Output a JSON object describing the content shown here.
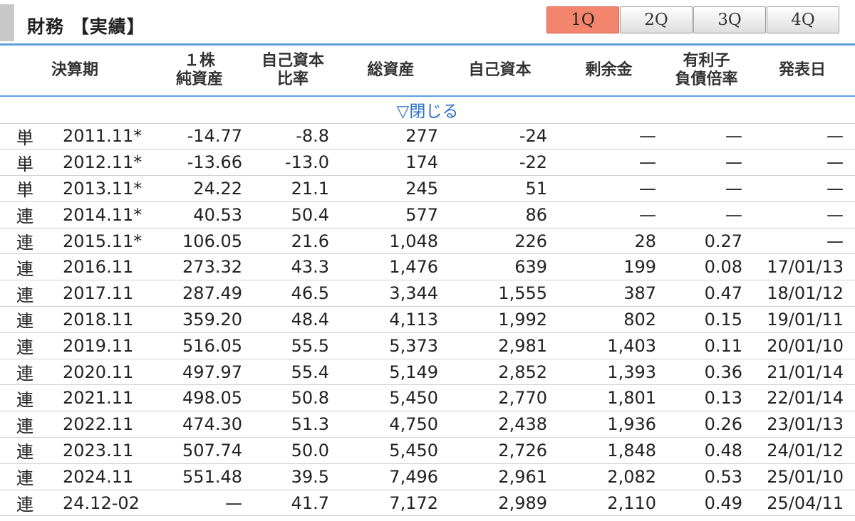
{
  "header": {
    "title": "財務 【実績】",
    "quarter_tabs": [
      {
        "label": "1Q",
        "active": true
      },
      {
        "label": "2Q",
        "active": false
      },
      {
        "label": "3Q",
        "active": false
      },
      {
        "label": "4Q",
        "active": false
      }
    ]
  },
  "table": {
    "columns": [
      {
        "line1": "決算期",
        "line2": ""
      },
      {
        "line1": "１株",
        "line2": "純資産"
      },
      {
        "line1": "自己資本",
        "line2": "比率"
      },
      {
        "line1": "総資産",
        "line2": ""
      },
      {
        "line1": "自己資本",
        "line2": ""
      },
      {
        "line1": "剰余金",
        "line2": ""
      },
      {
        "line1": "有利子",
        "line2": "負債倍率"
      },
      {
        "line1": "発表日",
        "line2": ""
      }
    ],
    "toggle_label": "▽閉じる",
    "rows": [
      [
        "単",
        "2011.11*",
        "-14.77",
        "-8.8",
        "277",
        "-24",
        "—",
        "—",
        "—"
      ],
      [
        "単",
        "2012.11*",
        "-13.66",
        "-13.0",
        "174",
        "-22",
        "—",
        "—",
        "—"
      ],
      [
        "単",
        "2013.11*",
        "24.22",
        "21.1",
        "245",
        "51",
        "—",
        "—",
        "—"
      ],
      [
        "連",
        "2014.11*",
        "40.53",
        "50.4",
        "577",
        "86",
        "—",
        "—",
        "—"
      ],
      [
        "連",
        "2015.11*",
        "106.05",
        "21.6",
        "1,048",
        "226",
        "28",
        "0.27",
        "—"
      ],
      [
        "連",
        "2016.11",
        "273.32",
        "43.3",
        "1,476",
        "639",
        "199",
        "0.08",
        "17/01/13"
      ],
      [
        "連",
        "2017.11",
        "287.49",
        "46.5",
        "3,344",
        "1,555",
        "387",
        "0.47",
        "18/01/12"
      ],
      [
        "連",
        "2018.11",
        "359.20",
        "48.4",
        "4,113",
        "1,992",
        "802",
        "0.15",
        "19/01/11"
      ],
      [
        "連",
        "2019.11",
        "516.05",
        "55.5",
        "5,373",
        "2,981",
        "1,403",
        "0.11",
        "20/01/10"
      ],
      [
        "連",
        "2020.11",
        "497.97",
        "55.4",
        "5,149",
        "2,852",
        "1,393",
        "0.36",
        "21/01/14"
      ],
      [
        "連",
        "2021.11",
        "498.05",
        "50.8",
        "5,450",
        "2,770",
        "1,801",
        "0.13",
        "22/01/14"
      ],
      [
        "連",
        "2022.11",
        "474.30",
        "51.3",
        "4,750",
        "2,438",
        "1,936",
        "0.26",
        "23/01/13"
      ],
      [
        "連",
        "2023.11",
        "507.74",
        "50.0",
        "5,450",
        "2,726",
        "1,848",
        "0.48",
        "24/01/12"
      ],
      [
        "連",
        "2024.11",
        "551.48",
        "39.5",
        "7,496",
        "2,961",
        "2,082",
        "0.53",
        "25/01/10"
      ],
      [
        "連",
        "24.12-02",
        "—",
        "41.7",
        "7,172",
        "2,989",
        "2,110",
        "0.49",
        "25/04/11"
      ]
    ]
  }
}
